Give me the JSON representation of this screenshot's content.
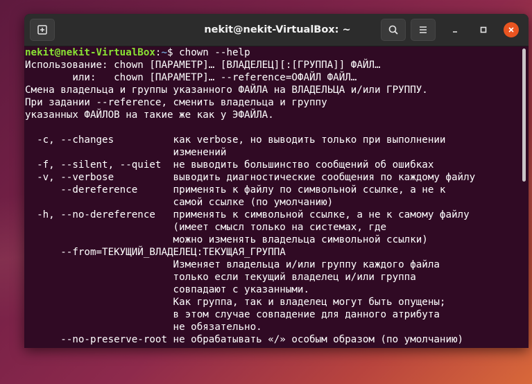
{
  "window": {
    "title": "nekit@nekit-VirtualBox: ~"
  },
  "icons": {
    "new_tab": "new-tab-icon",
    "search": "search-icon",
    "menu": "hamburger-menu-icon",
    "minimize": "minimize-icon",
    "maximize": "maximize-icon",
    "close": "close-icon"
  },
  "colors": {
    "terminal_bg": "#300a24",
    "prompt_user": "#8ae234",
    "prompt_path": "#729fcf",
    "close_button": "#e95420"
  },
  "terminal": {
    "prompt": {
      "user_host": "nekit@nekit-VirtualBox",
      "sep": ":",
      "path": "~",
      "symbol": "$ ",
      "command": "chown --help"
    },
    "lines": [
      "Использование: chown [ПАРАМЕТР]… [ВЛАДЕЛЕЦ][:[ГРУППА]] ФАЙЛ…",
      "        или:   chown [ПАРАМЕТР]… --reference=ОФАЙЛ ФАЙЛ…",
      "Смена владельца и группы указанного ФАЙЛА на ВЛАДЕЛЬЦА и/или ГРУППУ.",
      "При задании --reference, сменить владельца и группу",
      "указанных ФАЙЛОВ на такие же как у ЭФАЙЛА.",
      "",
      "  -c, --changes          как verbose, но выводить только при выполнении",
      "                         изменений",
      "  -f, --silent, --quiet  не выводить большинство сообщений об ошибках",
      "  -v, --verbose          выводить диагностические сообщения по каждому файлу",
      "      --dereference      применять к файлу по символьной ссылке, а не к",
      "                         самой ссылке (по умолчанию)",
      "  -h, --no-dereference   применять к символьной ссылке, а не к самому файлу",
      "                         (имеет смысл только на системах, где",
      "                         можно изменять владельца символьной ссылки)",
      "      --from=ТЕКУЩИЙ_ВЛАДЕЛЕЦ:ТЕКУЩАЯ_ГРУППА",
      "                         Изменяет владельца и/или группу каждого файла",
      "                         только если текущий владелец и/или группа",
      "                         совпадают с указанными.",
      "                         Как группа, так и владелец могут быть опущены;",
      "                         в этом случае совпадение для данного атрибута",
      "                         не обязательно.",
      "      --no-preserve-root не обрабатывать «/» особым образом (по умолчанию)"
    ]
  }
}
